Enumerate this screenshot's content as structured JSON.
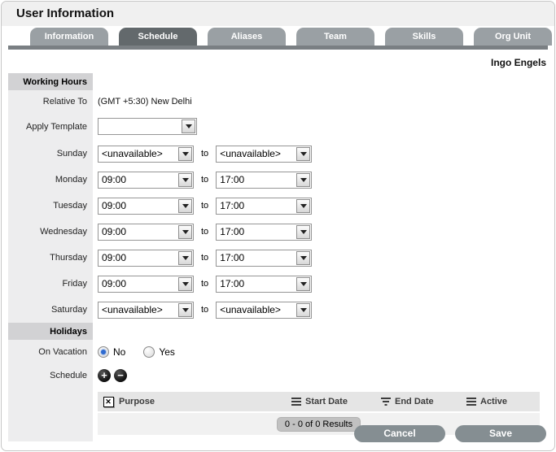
{
  "window": {
    "title": "User Information"
  },
  "tabs": [
    {
      "label": "Information",
      "active": false
    },
    {
      "label": "Schedule",
      "active": true
    },
    {
      "label": "Aliases",
      "active": false
    },
    {
      "label": "Team",
      "active": false
    },
    {
      "label": "Skills",
      "active": false
    },
    {
      "label": "Org Unit",
      "active": false
    }
  ],
  "user_name": "Ingo Engels",
  "working_hours": {
    "section_label": "Working Hours",
    "relative_to_label": "Relative To",
    "relative_to_value": "(GMT +5:30) New Delhi",
    "apply_template_label": "Apply Template",
    "apply_template_value": "",
    "to_label": "to",
    "days": [
      {
        "label": "Sunday",
        "from": "<unavailable>",
        "to": "<unavailable>"
      },
      {
        "label": "Monday",
        "from": "09:00",
        "to": "17:00"
      },
      {
        "label": "Tuesday",
        "from": "09:00",
        "to": "17:00"
      },
      {
        "label": "Wednesday",
        "from": "09:00",
        "to": "17:00"
      },
      {
        "label": "Thursday",
        "from": "09:00",
        "to": "17:00"
      },
      {
        "label": "Friday",
        "from": "09:00",
        "to": "17:00"
      },
      {
        "label": "Saturday",
        "from": "<unavailable>",
        "to": "<unavailable>"
      }
    ]
  },
  "holidays": {
    "section_label": "Holidays",
    "on_vacation_label": "On Vacation",
    "options": [
      {
        "label": "No",
        "selected": true
      },
      {
        "label": "Yes",
        "selected": false
      }
    ],
    "schedule_label": "Schedule",
    "table": {
      "columns": {
        "purpose": "Purpose",
        "start_date": "Start Date",
        "end_date": "End Date",
        "active": "Active"
      },
      "results_text": "0 - 0 of 0 Results"
    }
  },
  "footer": {
    "cancel_label": "Cancel",
    "save_label": "Save"
  },
  "colors": {
    "tab_inactive": "#9aa0a4",
    "tab_active": "#63696c",
    "section_header_bg": "#d2d2d4",
    "label_column_bg": "#ededee",
    "accent_radio": "#2f6bd0",
    "button_bg": "#858e92"
  }
}
